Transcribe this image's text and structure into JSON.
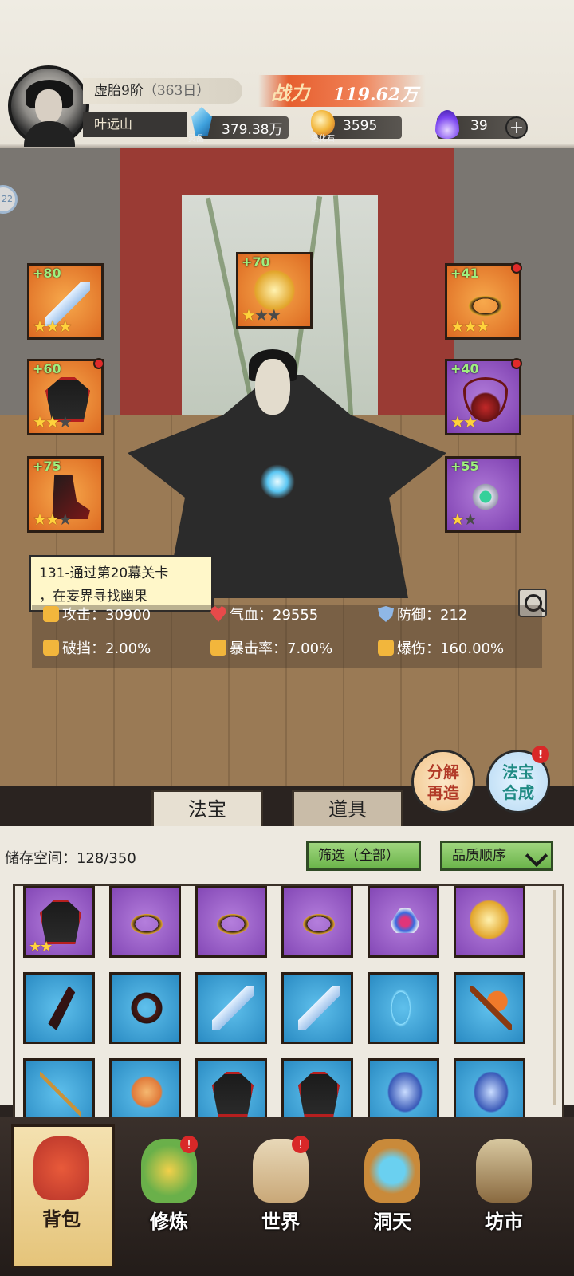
{
  "player": {
    "realm": "虚胎9阶",
    "realm_sub": "（363日）",
    "name": "叶远山",
    "power_label": "战力",
    "power_value": "119.62万"
  },
  "resources": [
    {
      "name": "灵晶",
      "value": "379.38万",
      "icon": "crystal-icon"
    },
    {
      "name": "造化石",
      "value": "3595",
      "icon": "ore-icon"
    },
    {
      "name": "",
      "value": "39",
      "icon": "spirit-flame-icon"
    }
  ],
  "side_bubble": "22",
  "equipment": [
    {
      "slot": "weapon",
      "level": "+80",
      "rarity": "orange",
      "stars": 3,
      "max_stars": 3,
      "alert": false,
      "icon": "sword-icon"
    },
    {
      "slot": "talisman",
      "level": "+70",
      "rarity": "orange",
      "stars": 1,
      "max_stars": 3,
      "alert": false,
      "icon": "golden-cloud-icon"
    },
    {
      "slot": "headband",
      "level": "+41",
      "rarity": "orange",
      "stars": 3,
      "max_stars": 3,
      "alert": true,
      "icon": "headband-icon"
    },
    {
      "slot": "robe",
      "level": "+60",
      "rarity": "orange",
      "stars": 2,
      "max_stars": 3,
      "alert": true,
      "icon": "robe-icon"
    },
    {
      "slot": "necklace",
      "level": "+40",
      "rarity": "purple",
      "stars": 2,
      "max_stars": 2,
      "alert": true,
      "icon": "necklace-icon"
    },
    {
      "slot": "boots",
      "level": "+75",
      "rarity": "orange",
      "stars": 2,
      "max_stars": 3,
      "alert": false,
      "icon": "boots-icon"
    },
    {
      "slot": "ring",
      "level": "+55",
      "rarity": "purple",
      "stars": 1,
      "max_stars": 2,
      "alert": false,
      "icon": "ring-icon"
    }
  ],
  "quest": {
    "line1": "131-通过第20幕关卡",
    "line2": "，在妄界寻找幽果"
  },
  "stats": {
    "attack_label": "攻击：",
    "attack_value": "30900",
    "hp_label": "气血：",
    "hp_value": "29555",
    "def_label": "防御：",
    "def_value": "212",
    "pierce_label": "破挡：",
    "pierce_value": "2.00%",
    "crit_label": "暴击率：",
    "crit_value": "7.00%",
    "critdmg_label": "爆伤：",
    "critdmg_value": "160.00%"
  },
  "actions": {
    "forge_line1": "分解",
    "forge_line2": "再造",
    "synth_line1": "法宝",
    "synth_line2": "合成",
    "synth_badge": "!"
  },
  "tabs": {
    "fabao": "法宝",
    "daoju": "道具"
  },
  "inventory": {
    "storage_label": "储存空间：",
    "storage_value": "128/350",
    "filter_label": "筛选（全部）",
    "sort_label": "品质顺序",
    "items": [
      {
        "rarity": "purple",
        "icon": "robe-icon",
        "stars": 2
      },
      {
        "rarity": "purple",
        "icon": "headband-icon",
        "stars": 0
      },
      {
        "rarity": "purple",
        "icon": "headband-icon",
        "stars": 0
      },
      {
        "rarity": "purple",
        "icon": "headband-icon",
        "stars": 0
      },
      {
        "rarity": "purple",
        "icon": "taiji-amulet-icon",
        "stars": 0
      },
      {
        "rarity": "purple",
        "icon": "golden-cloud-icon",
        "stars": 0
      },
      {
        "rarity": "blue",
        "icon": "dark-blade-icon",
        "stars": 0
      },
      {
        "rarity": "blue",
        "icon": "thorn-ring-icon",
        "stars": 0
      },
      {
        "rarity": "blue",
        "icon": "sword-icon",
        "stars": 0
      },
      {
        "rarity": "blue",
        "icon": "sword-icon",
        "stars": 0
      },
      {
        "rarity": "blue",
        "icon": "bow-icon",
        "stars": 0
      },
      {
        "rarity": "blue",
        "icon": "axe-icon",
        "stars": 0
      },
      {
        "rarity": "blue",
        "icon": "staff-icon",
        "stars": 0
      },
      {
        "rarity": "blue",
        "icon": "beast-icon",
        "stars": 0
      },
      {
        "rarity": "blue",
        "icon": "robe-icon",
        "stars": 0
      },
      {
        "rarity": "blue",
        "icon": "robe-icon",
        "stars": 0
      },
      {
        "rarity": "blue",
        "icon": "armor-icon",
        "stars": 0
      },
      {
        "rarity": "blue",
        "icon": "armor-icon",
        "stars": 0
      }
    ]
  },
  "nav": [
    {
      "label": "背包",
      "icon": "bag-icon",
      "badge": "",
      "active": true
    },
    {
      "label": "修炼",
      "icon": "lotus-icon",
      "badge": "!",
      "active": false
    },
    {
      "label": "世界",
      "icon": "scroll-map-icon",
      "badge": "!",
      "active": false
    },
    {
      "label": "洞天",
      "icon": "portal-icon",
      "badge": "",
      "active": false
    },
    {
      "label": "坊市",
      "icon": "market-icon",
      "badge": "",
      "active": false
    }
  ],
  "colors": {
    "orange_rarity": "#dd6a22",
    "purple_rarity": "#7d3fb0",
    "blue_rarity": "#2a8bc3",
    "level_text": "#9ff07f",
    "power_banner": "#e65f2f",
    "alert_red": "#e02a2a"
  }
}
